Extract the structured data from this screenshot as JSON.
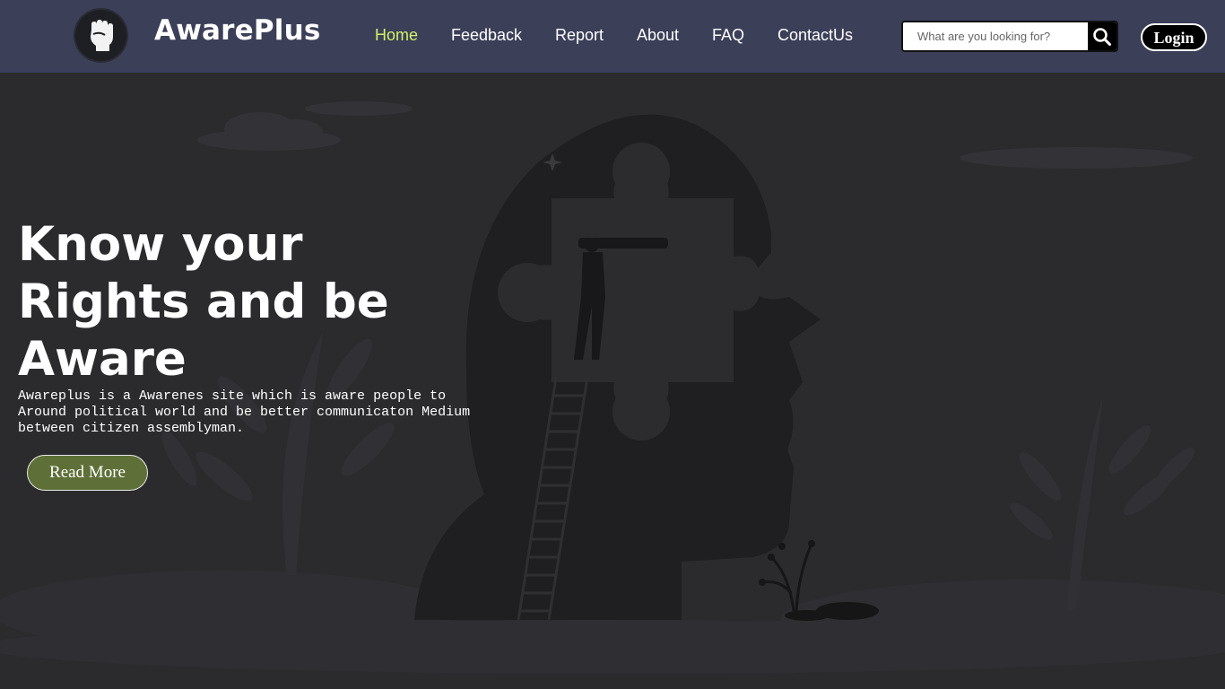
{
  "brand": {
    "name": "AwarePlus",
    "logo_icon": "raised-fist-icon"
  },
  "nav": {
    "items": [
      {
        "label": "Home",
        "active": true
      },
      {
        "label": "Feedback",
        "active": false
      },
      {
        "label": "Report",
        "active": false
      },
      {
        "label": "About",
        "active": false
      },
      {
        "label": "FAQ",
        "active": false
      },
      {
        "label": "ContactUs",
        "active": false
      }
    ],
    "active_color": "#d4f26a"
  },
  "search": {
    "placeholder": "What are you looking for?",
    "value": "",
    "icon": "search-icon"
  },
  "login": {
    "label": "Login"
  },
  "hero": {
    "title": "Know your Rights and be Aware",
    "description": "Awareplus is a Awarenes site which is aware people to Around political world and be better communicaton Medium between citizen assemblyman.",
    "cta_label": "Read More",
    "illustration": "head-silhouette-puzzle-ladder-illustration"
  },
  "colors": {
    "navbar_bg": "#3b3f58",
    "hero_bg": "#2b2b2e",
    "cta_bg": "#5e7038"
  }
}
